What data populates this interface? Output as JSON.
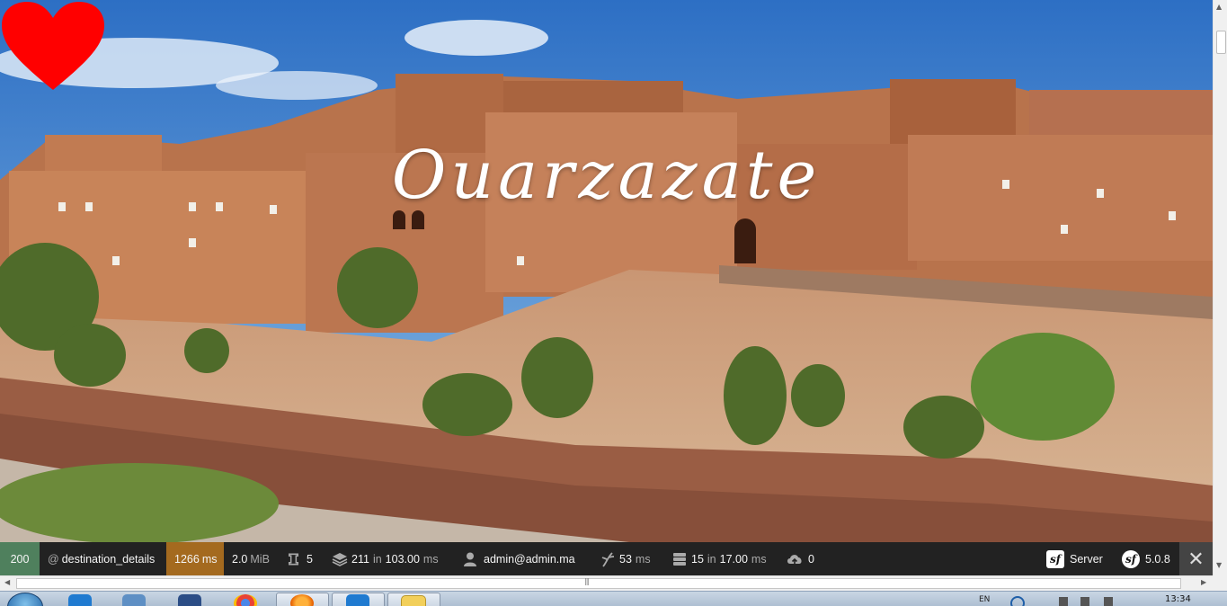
{
  "hero": {
    "title": "Ouarzazate",
    "heart_color": "#ff0000",
    "image_subject": "kasbah-landscape"
  },
  "toolbar": {
    "status_code": "200",
    "status_color": "#4f805d",
    "route": "destination_details",
    "time": {
      "value": "1266",
      "unit": "ms",
      "color": "#a46a1f"
    },
    "memory": {
      "value": "2.0",
      "unit": "MiB"
    },
    "forms": {
      "value": "5"
    },
    "cache": {
      "value": "211",
      "in": "in",
      "time": "103.00",
      "unit": "ms"
    },
    "user": "admin@admin.ma",
    "twig": {
      "value": "53",
      "unit": "ms"
    },
    "db": {
      "value": "15",
      "in": "in",
      "time": "17.00",
      "unit": "ms"
    },
    "http_client": {
      "value": "0"
    },
    "server_label": "Server",
    "symfony_version": "5.0.8",
    "close_icon": "close-icon"
  },
  "scrollbar": {
    "grip": "|||"
  },
  "taskbar": {
    "language": "EN",
    "clock": "13:34",
    "apps": [
      "start-orb",
      "vscode-icon",
      "file-manager-icon",
      "virtualbox-icon",
      "chrome-icon",
      "firefox-icon",
      "vscode-icon",
      "folder-icon"
    ]
  }
}
